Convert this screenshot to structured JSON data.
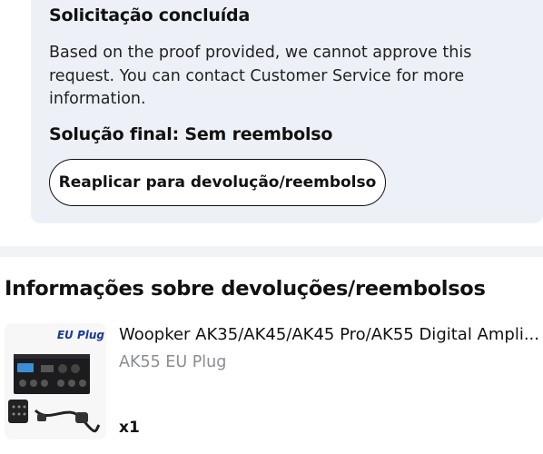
{
  "status": {
    "title": "Solicitação concluída",
    "message": "Based on the proof provided, we cannot approve this request. You can contact Customer Service for more information.",
    "final_solution": "Solução final: Sem reembolso",
    "reapply_label": "Reaplicar para devolução/reembolso"
  },
  "returns_section": {
    "heading": "Informações sobre devoluções/reembolsos"
  },
  "product": {
    "title": "Woopker AK35/AK45/AK45 Pro/AK55 Digital Ampli...",
    "variant": "AK55 EU Plug",
    "quantity": "x1",
    "thumb_tag": "EU Plug",
    "thumb_icon": "amplifier-product-image"
  },
  "colors": {
    "card_background": "#edf1f7",
    "muted_text": "#8a8d93",
    "tag_blue": "#1b3a9a"
  }
}
